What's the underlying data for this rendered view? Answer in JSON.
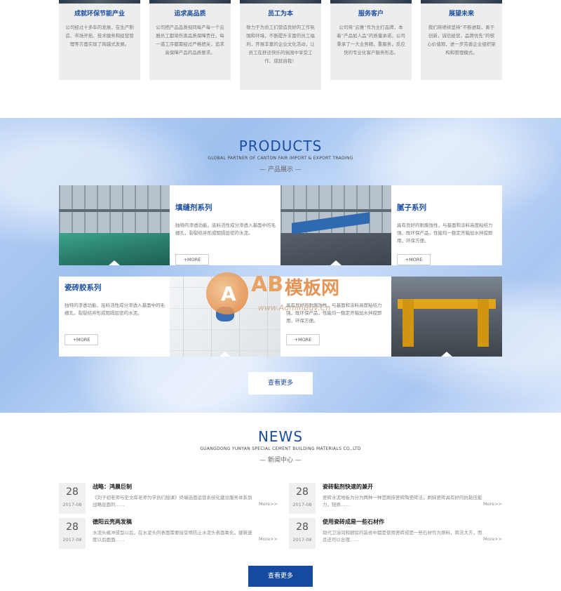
{
  "values": [
    {
      "title": "成就环保节能产业",
      "text": "公司经过十多年的发展，在生产制造、市场开拓、技术服务和经营管理等方面实现了跨越式发展。"
    },
    {
      "title": "追求高品质",
      "text": "公司把产品品质视同每产每一个云雅员工都将伤害品质保障责任，每一道工序都需经过严格把关，追求高保障产品的品质要求。"
    },
    {
      "title": "员工为本",
      "text": "致力于为员工们营造良好的工作氛围和环境，不断提升丰富的员工福利，开展丰富的企业文化活动，让员工在舒适快乐的氛围中享受工作、成就自我！"
    },
    {
      "title": "服务客户",
      "text": "公司将“云雅”作为主打品牌，本着“产品如人品”的质量承诺，公司秉承了一大业务精，重服务，反应快的专业化客户服务形态。"
    },
    {
      "title": "展望未来",
      "text": "我们将继续坚持“不断进取，勇于创新，诚信经营，品牌优先”的核心价值观，进一步完善企业组织架构和管理模式。"
    }
  ],
  "products": {
    "title_en": "PRODUCTS",
    "subtitle": "GLOBAL PARTNER OF CANTON FAIR IMPORT & EXPORT TRADING",
    "title_cn": "— 产品展示 —",
    "items": [
      {
        "title": "填缝剂系列",
        "text": "独特的渗透功能，底料活性成分渗透入基面中的毛细孔，裂裂结并形成阻隔层密的水泥。",
        "btn": "+MORE"
      },
      {
        "title": "腻子系列",
        "text": "具有良好的耐腐蚀性，与基面和涂料高度粘结力强。既环保产品，性能均一稳定开箱加水拌搅即用，环保方便。",
        "btn": "+MORE"
      },
      {
        "title": "瓷砖胶系列",
        "text": "独特的渗透功能，底料活性成分渗透入基面中的毛细孔，裂裂结并形成阻隔层密的水泥。",
        "btn": "+MORE"
      },
      {
        "title": "",
        "text": "具有良好的耐腐蚀性，与基面和涂料高度粘结力强。既环保产品，性能均一稳定开箱加水拌搅即用，环保方便。",
        "btn": "+MORE"
      }
    ],
    "more": "查看更多"
  },
  "watermark": {
    "letters": "AB",
    "cn": "模板网",
    "url": "www.AdminBuy.Cn"
  },
  "news": {
    "title_en": "NEWS",
    "subtitle": "GUANGDONG YUNYAN SPECIAL CEMENT BUILDING MATERIALS CO.,LTD",
    "title_cn": "— 新闻中心 —",
    "items": [
      {
        "day": "28",
        "ym": "2017-08",
        "title": "战略：鸿晨巨制",
        "desc": "《刘子初老师与史文库老师为学员们授课》终端选面运营系统化建设服务体系到战略层面的……",
        "more": "More>>"
      },
      {
        "day": "28",
        "ym": "2017-08",
        "title": "瓷砖黏剂快速的兼开",
        "desc": "瓷砖水泥地板为分为两种一种是刷抹瓷砖陶瓷砖法，刷抹瓷砖具有好的抗黏压能力，轻质……",
        "more": "More>>"
      },
      {
        "day": "28",
        "ym": "2017-08",
        "title": "德阳云壳两发稿",
        "desc": "水泥头被冲成型以后，在水泥头的表面需要接受喷防止水泥头表面氧化，建筑速度以后面面……",
        "more": "More>>"
      },
      {
        "day": "28",
        "ym": "2017-08",
        "title": "使用瓷砖成是一些石材作",
        "desc": "现代卫浴间和厨房的装修中都是使用瓷砖成是一些石材作为原料，简洁大方，而且还可以合理……",
        "more": "More>>"
      }
    ],
    "more": "查看更多"
  }
}
